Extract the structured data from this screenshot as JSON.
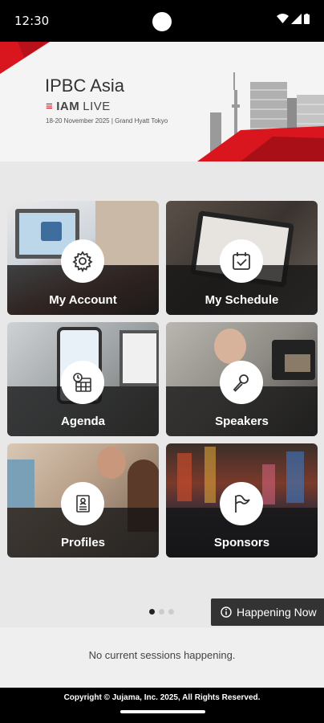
{
  "status_bar": {
    "time": "12:30",
    "icons": [
      "wifi-icon",
      "signal-icon",
      "battery-icon"
    ]
  },
  "banner": {
    "title": "IPBC Asia",
    "logo_iam": "IAM",
    "logo_live": "LIVE",
    "subtitle": "18-20 November 2025 | Grand Hyatt Tokyo"
  },
  "tiles": [
    {
      "label": "My Account",
      "icon": "gear-icon"
    },
    {
      "label": "My Schedule",
      "icon": "calendar-check-icon"
    },
    {
      "label": "Agenda",
      "icon": "calendar-clock-icon"
    },
    {
      "label": "Speakers",
      "icon": "microphone-icon"
    },
    {
      "label": "Profiles",
      "icon": "profile-card-icon"
    },
    {
      "label": "Sponsors",
      "icon": "flag-icon"
    }
  ],
  "pager": {
    "count": 3,
    "active": 0
  },
  "happening_now": {
    "label": "Happening Now",
    "icon": "info-icon"
  },
  "sessions": {
    "empty_text": "No current sessions happening."
  },
  "footer": {
    "copyright": "Copyright © Jujama, Inc. 2025, All Rights Reserved."
  },
  "colors": {
    "brand_red": "#d9151d",
    "dark": "#333333",
    "background": "#e8e8e8"
  }
}
